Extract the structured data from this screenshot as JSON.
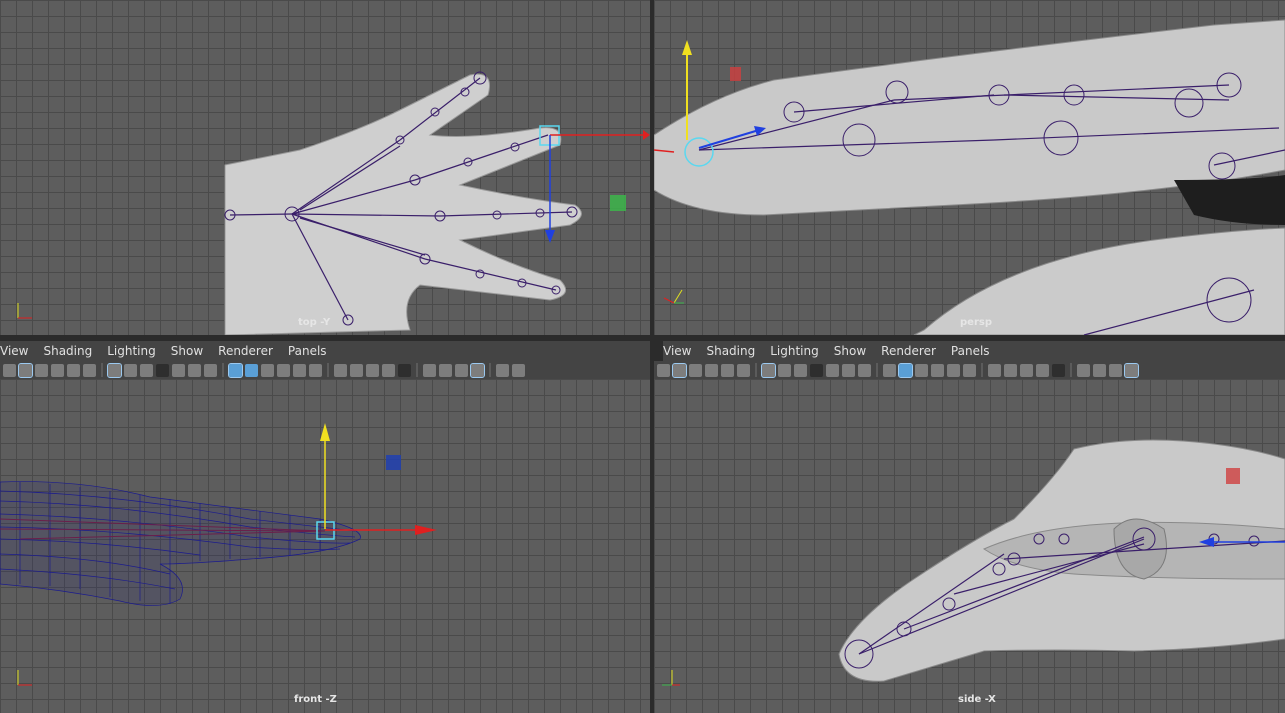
{
  "viewports": {
    "top": {
      "label": "top -Y"
    },
    "persp": {
      "label": "persp"
    },
    "front": {
      "label": "front -Z"
    },
    "side": {
      "label": "side -X"
    }
  },
  "panel_menu": {
    "items": [
      "View",
      "Shading",
      "Lighting",
      "Show",
      "Renderer",
      "Panels"
    ]
  },
  "colors": {
    "joint": "#3a1f6a",
    "x_axis": "#e02020",
    "y_axis": "#f0e020",
    "z_axis": "#2040e0",
    "selection": "#5ad8f0",
    "wireframe": "#1c1c8c"
  }
}
